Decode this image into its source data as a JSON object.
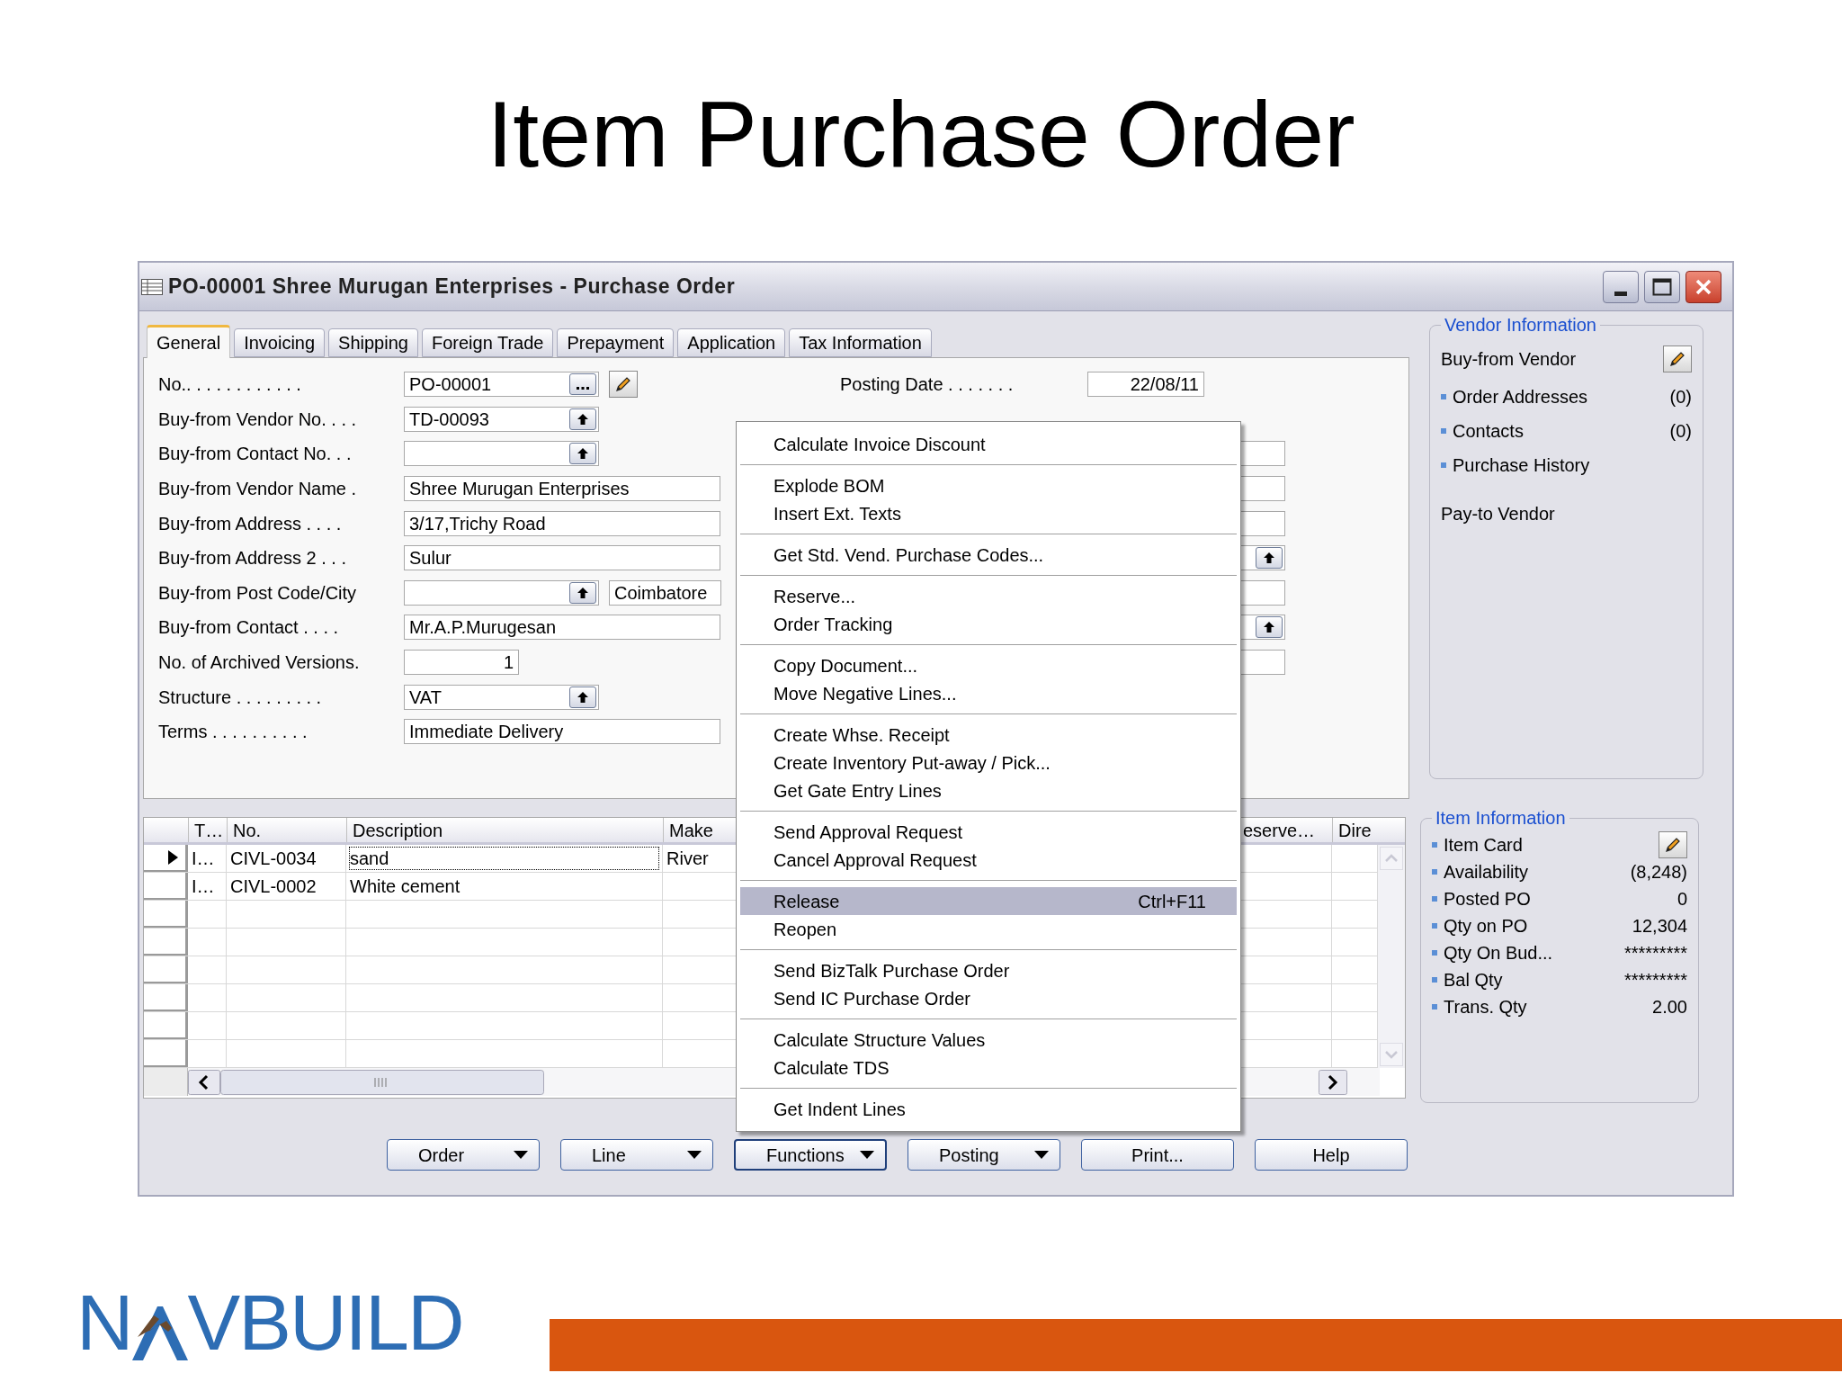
{
  "slide": {
    "title": "Item Purchase Order"
  },
  "window": {
    "title": "PO-00001 Shree Murugan Enterprises - Purchase Order"
  },
  "tabs": [
    {
      "label": "General",
      "selected": true
    },
    {
      "label": "Invoicing",
      "selected": false
    },
    {
      "label": "Shipping",
      "selected": false
    },
    {
      "label": "Foreign Trade",
      "selected": false
    },
    {
      "label": "Prepayment",
      "selected": false
    },
    {
      "label": "Application",
      "selected": false
    },
    {
      "label": "Tax Information",
      "selected": false
    }
  ],
  "general": {
    "left_fields": [
      {
        "label": "No.. . . . . . . . . . . .",
        "value": "PO-00001",
        "kind": "assist",
        "edit_button": true
      },
      {
        "label": "Buy-from Vendor No. . . .",
        "value": "TD-00093",
        "kind": "lookup"
      },
      {
        "label": "Buy-from Contact No. . .",
        "kind": "lookup"
      },
      {
        "label": "Buy-from Vendor Name .",
        "value": "Shree Murugan Enterprises",
        "kind": "text"
      },
      {
        "label": "Buy-from Address . . . .",
        "value": "3/17,Trichy Road",
        "kind": "text"
      },
      {
        "label": "Buy-from Address 2 . . .",
        "value": "Sulur",
        "kind": "text"
      },
      {
        "label": "Buy-from Post Code/City",
        "city": "Coimbatore",
        "kind": "city"
      },
      {
        "label": "Buy-from Contact . . . .",
        "value": "Mr.A.P.Murugesan",
        "kind": "text"
      },
      {
        "label": "No. of Archived Versions.",
        "value": "1",
        "kind": "number"
      },
      {
        "label": "Structure . . . . . . . . .",
        "value": "VAT",
        "kind": "lookup"
      },
      {
        "label": "Terms . . . . . . . . . .",
        "value": "Immediate Delivery",
        "kind": "text"
      }
    ],
    "right_fields": [
      {
        "label": "Posting Date . . . . . . .",
        "value": "22/08/11",
        "kind": "date"
      },
      {
        "kind": "box"
      },
      {
        "kind": "box"
      },
      {
        "kind": "box"
      },
      {
        "kind": "lookup"
      },
      {
        "kind": "box"
      },
      {
        "kind": "lookup"
      },
      {
        "kind": "box"
      }
    ]
  },
  "lines": {
    "columns": [
      "T…",
      "No.",
      "Description",
      "Make",
      "eserve…",
      "Dire"
    ],
    "rows": [
      {
        "selected": true,
        "cells": [
          "I…",
          "CIVL-0034",
          "sand",
          "River"
        ]
      },
      {
        "selected": false,
        "cells": [
          "I…",
          "CIVL-0002",
          "White cement"
        ]
      }
    ]
  },
  "menu": {
    "groups": [
      {
        "items": [
          {
            "label": "Calculate Invoice Discount",
            "selected": false
          }
        ]
      },
      {
        "items": [
          {
            "label": "Explode BOM",
            "selected": false
          },
          {
            "label": "Insert Ext. Texts",
            "selected": false
          }
        ]
      },
      {
        "items": [
          {
            "label": "Get Std. Vend. Purchase Codes...",
            "selected": false
          }
        ]
      },
      {
        "items": [
          {
            "label": "Reserve...",
            "selected": false
          },
          {
            "label": "Order Tracking",
            "selected": false
          }
        ]
      },
      {
        "items": [
          {
            "label": "Copy Document...",
            "selected": false
          },
          {
            "label": "Move Negative Lines...",
            "selected": false
          }
        ]
      },
      {
        "items": [
          {
            "label": "Create Whse. Receipt",
            "selected": false
          },
          {
            "label": "Create Inventory Put-away / Pick...",
            "selected": false
          },
          {
            "label": "Get Gate Entry Lines",
            "selected": false
          }
        ]
      },
      {
        "items": [
          {
            "label": "Send Approval Request",
            "selected": false
          },
          {
            "label": "Cancel Approval Request",
            "selected": false
          }
        ]
      },
      {
        "items": [
          {
            "label": "Release",
            "shortcut": "Ctrl+F11",
            "selected": true
          },
          {
            "label": "Reopen",
            "selected": false
          }
        ]
      },
      {
        "items": [
          {
            "label": "Send BizTalk Purchase Order",
            "selected": false
          },
          {
            "label": "Send IC Purchase Order",
            "selected": false
          }
        ]
      },
      {
        "items": [
          {
            "label": "Calculate Structure Values",
            "selected": false
          },
          {
            "label": "Calculate TDS",
            "selected": false
          }
        ]
      },
      {
        "items": [
          {
            "label": "Get Indent Lines",
            "selected": false
          }
        ]
      }
    ]
  },
  "buttons": [
    {
      "label": "Order",
      "dropdown": true,
      "active": false
    },
    {
      "label": "Line",
      "dropdown": true,
      "active": false
    },
    {
      "label": "Functions",
      "dropdown": true,
      "active": true
    },
    {
      "label": "Posting",
      "dropdown": true,
      "active": false
    },
    {
      "label": "Print...",
      "active": false
    },
    {
      "label": "Help",
      "active": false
    }
  ],
  "info_panels": [
    {
      "title": "Vendor Information",
      "entries": [
        {
          "kind": "heading",
          "label": "Buy-from Vendor",
          "edit_button": true
        },
        {
          "kind": "link",
          "label": "Order Addresses",
          "value": "(0)"
        },
        {
          "kind": "link",
          "label": "Contacts",
          "value": "(0)"
        },
        {
          "kind": "link",
          "label": "Purchase History"
        },
        {
          "kind": "heading",
          "label": "Pay-to Vendor"
        }
      ]
    },
    {
      "title": "Item Information",
      "entries": [
        {
          "kind": "link",
          "label": "Item Card",
          "edit_button": true
        },
        {
          "kind": "link",
          "label": "Availability",
          "value": "(8,248)"
        },
        {
          "kind": "link",
          "label": "Posted PO",
          "value": "0"
        },
        {
          "kind": "link",
          "label": "Qty on PO",
          "value": "12,304"
        },
        {
          "kind": "link",
          "label": "Qty On Bud...",
          "value": "*********"
        },
        {
          "kind": "link",
          "label": "Bal Qty",
          "value": "*********"
        },
        {
          "kind": "link",
          "label": "Trans. Qty",
          "value": "2.00"
        }
      ]
    }
  ],
  "footer": {
    "logo_before": "N",
    "logo_after": "VBUILD"
  }
}
